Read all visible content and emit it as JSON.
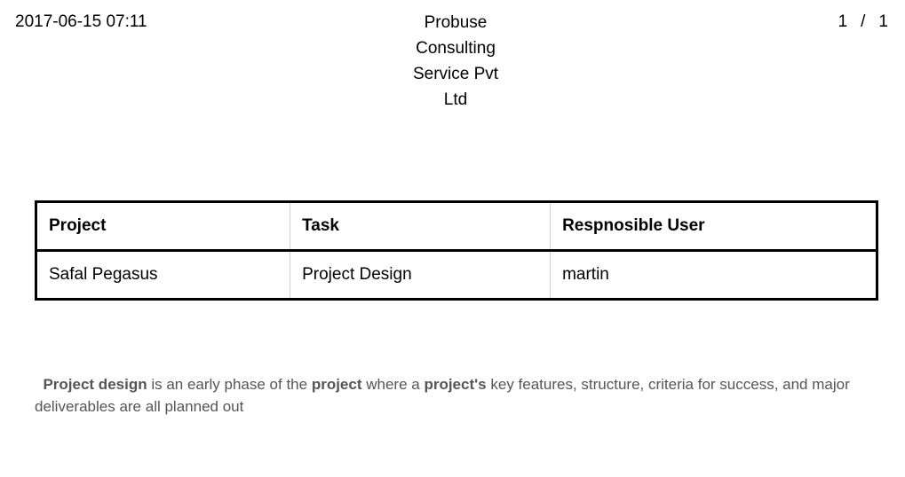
{
  "header": {
    "datetime": "2017-06-15 07:11",
    "company_lines": [
      "Probuse",
      "Consulting",
      "Service Pvt",
      "Ltd"
    ],
    "page_current": "1",
    "page_separator": "/",
    "page_total": "1"
  },
  "table": {
    "columns": [
      "Project",
      "Task",
      "Respnosible User"
    ],
    "rows": [
      [
        "Safal Pegasus",
        "Project Design",
        "martin"
      ]
    ]
  },
  "description": {
    "t1": "Project design",
    "t2": " is an early phase of the ",
    "t3": "project",
    "t4": " where a ",
    "t5": "project's",
    "t6": " key features, structure, criteria for success, and major deliverables are all planned out"
  }
}
